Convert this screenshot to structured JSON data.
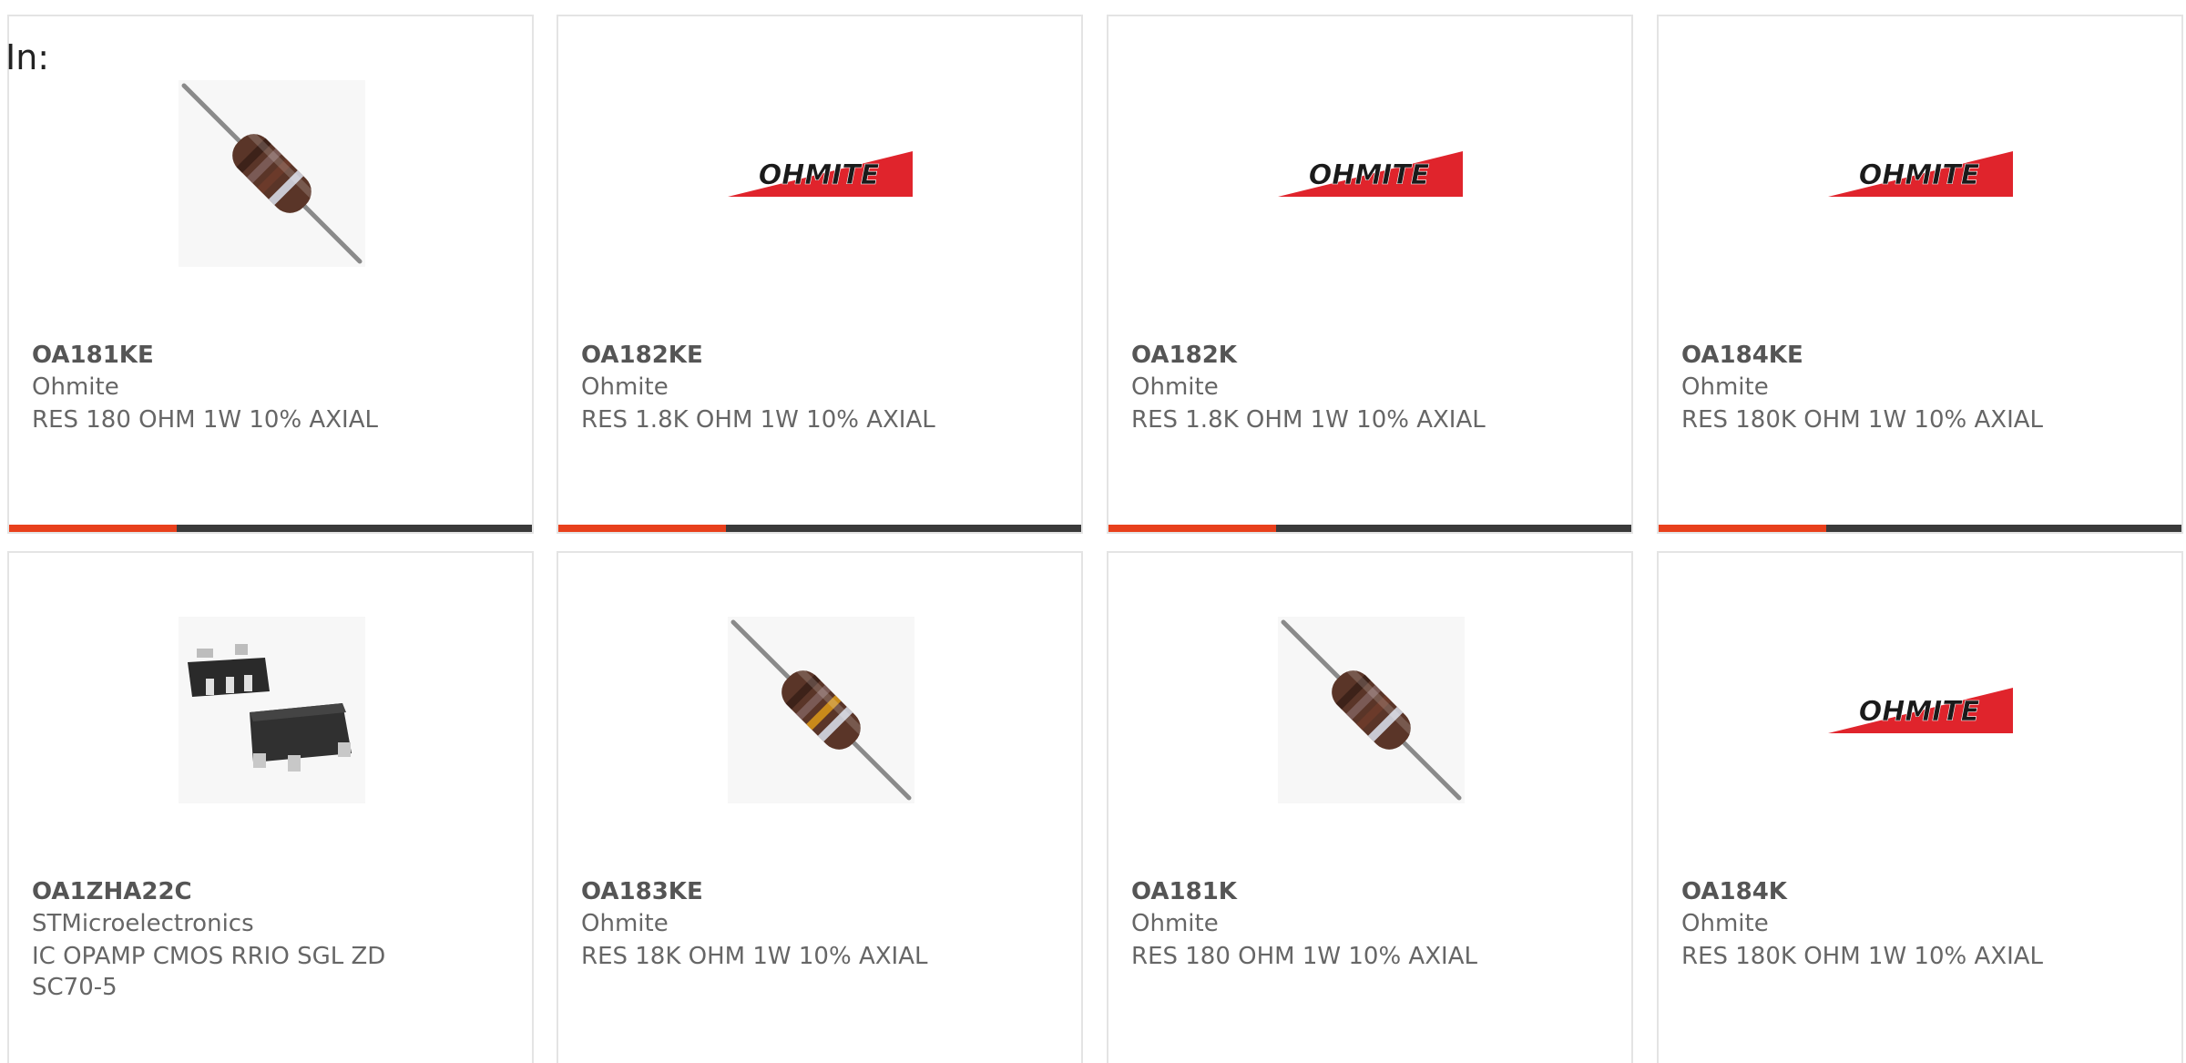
{
  "header": {
    "in_label": "In:"
  },
  "colors": {
    "accent": "#e8401c",
    "bar_track": "#3a3a3a",
    "card_border": "#e4e4e4",
    "ohmite_red": "#e0242c"
  },
  "products": [
    {
      "part": "OA181KE",
      "manufacturer": "Ohmite",
      "description": "RES 180 OHM 1W 10% AXIAL",
      "image": "resistor-brown-icon",
      "progress_fraction": 0.32
    },
    {
      "part": "OA182KE",
      "manufacturer": "Ohmite",
      "description": "RES 1.8K OHM 1W 10% AXIAL",
      "image": "ohmite-logo",
      "logo_text": "OHMITE",
      "progress_fraction": 0.32
    },
    {
      "part": "OA182K",
      "manufacturer": "Ohmite",
      "description": "RES 1.8K OHM 1W 10% AXIAL",
      "image": "ohmite-logo",
      "logo_text": "OHMITE",
      "progress_fraction": 0.32
    },
    {
      "part": "OA184KE",
      "manufacturer": "Ohmite",
      "description": "RES 180K OHM 1W 10% AXIAL",
      "image": "ohmite-logo",
      "logo_text": "OHMITE",
      "progress_fraction": 0.32
    },
    {
      "part": "OA1ZHA22C",
      "manufacturer": "STMicroelectronics",
      "description": "IC OPAMP CMOS RRIO SGL ZD SC70-5",
      "image": "ic-package-icon"
    },
    {
      "part": "OA183KE",
      "manufacturer": "Ohmite",
      "description": "RES 18K OHM 1W 10% AXIAL",
      "image": "resistor-orange-icon"
    },
    {
      "part": "OA181K",
      "manufacturer": "Ohmite",
      "description": "RES 180 OHM 1W 10% AXIAL",
      "image": "resistor-brown-icon"
    },
    {
      "part": "OA184K",
      "manufacturer": "Ohmite",
      "description": "RES 180K OHM 1W 10% AXIAL",
      "image": "ohmite-logo",
      "logo_text": "OHMITE"
    }
  ]
}
